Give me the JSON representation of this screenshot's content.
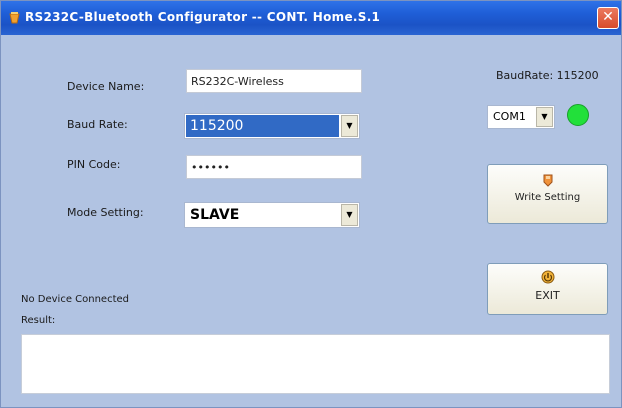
{
  "window": {
    "title": "RS232C-Bluetooth Configurator -- CONT. Home.S.1",
    "close_glyph": "✕"
  },
  "form": {
    "device_name": {
      "label": "Device Name:",
      "value": "RS232C-Wireless"
    },
    "baud_rate": {
      "label": "Baud Rate:",
      "value": "115200"
    },
    "pin_code": {
      "label": "PIN Code:",
      "value": "••••••"
    },
    "mode_setting": {
      "label": "Mode Setting:",
      "value": "SLAVE"
    }
  },
  "port": {
    "baud_status_label": "BaudRate: 115200",
    "com_value": "COM1",
    "led_color": "#22e03a"
  },
  "buttons": {
    "write_setting": {
      "label": "Write Setting",
      "icon": "write-icon"
    },
    "exit": {
      "label": "EXIT",
      "icon": "exit-icon"
    }
  },
  "status": {
    "message": "No Device Connected",
    "result_label": "Result:"
  },
  "combo_arrow": "▼"
}
